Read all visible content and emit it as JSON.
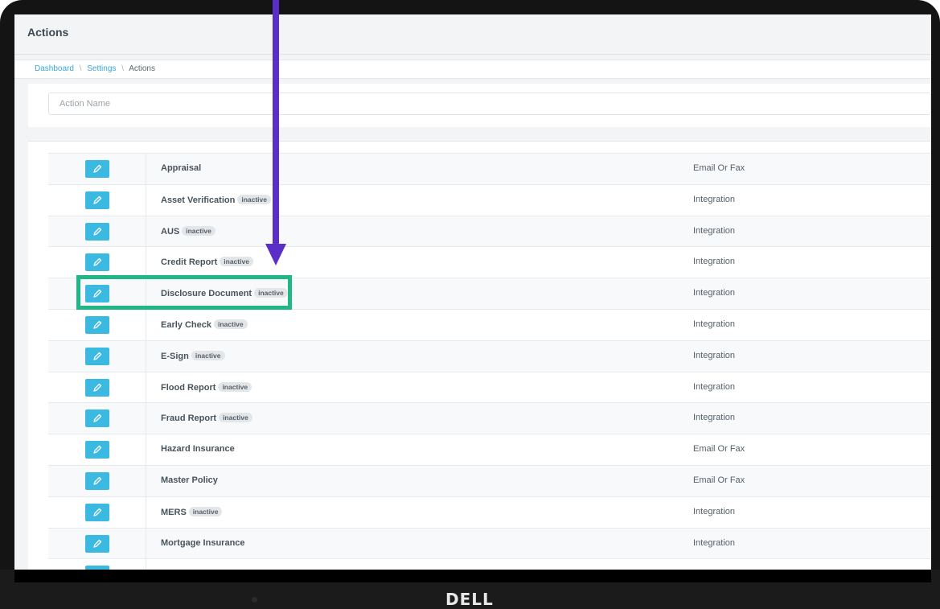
{
  "page": {
    "title": "Actions"
  },
  "breadcrumb": {
    "items": [
      "Dashboard",
      "Settings",
      "Actions"
    ]
  },
  "filter": {
    "placeholder": "Action Name"
  },
  "badge_text": "inactive",
  "actions": [
    {
      "name": "Appraisal",
      "inactive": false,
      "type": "Email Or Fax"
    },
    {
      "name": "Asset Verification",
      "inactive": true,
      "type": "Integration"
    },
    {
      "name": "AUS",
      "inactive": true,
      "type": "Integration"
    },
    {
      "name": "Credit Report",
      "inactive": true,
      "type": "Integration"
    },
    {
      "name": "Disclosure Document",
      "inactive": true,
      "type": "Integration"
    },
    {
      "name": "Early Check",
      "inactive": true,
      "type": "Integration"
    },
    {
      "name": "E-Sign",
      "inactive": true,
      "type": "Integration"
    },
    {
      "name": "Flood Report",
      "inactive": true,
      "type": "Integration"
    },
    {
      "name": "Fraud Report",
      "inactive": true,
      "type": "Integration"
    },
    {
      "name": "Hazard Insurance",
      "inactive": false,
      "type": "Email Or Fax"
    },
    {
      "name": "Master Policy",
      "inactive": false,
      "type": "Email Or Fax"
    },
    {
      "name": "MERS",
      "inactive": true,
      "type": "Integration"
    },
    {
      "name": "Mortgage Insurance",
      "inactive": false,
      "type": "Integration"
    },
    {
      "name": "",
      "inactive": false,
      "type": ""
    }
  ],
  "device": {
    "brand": "DELL"
  },
  "colors": {
    "accent": "#3bb9e0",
    "link": "#39a8d8",
    "highlight": "#1fb786",
    "arrow": "#5b2fc7"
  },
  "icons": {
    "edit": "pencil-icon"
  }
}
